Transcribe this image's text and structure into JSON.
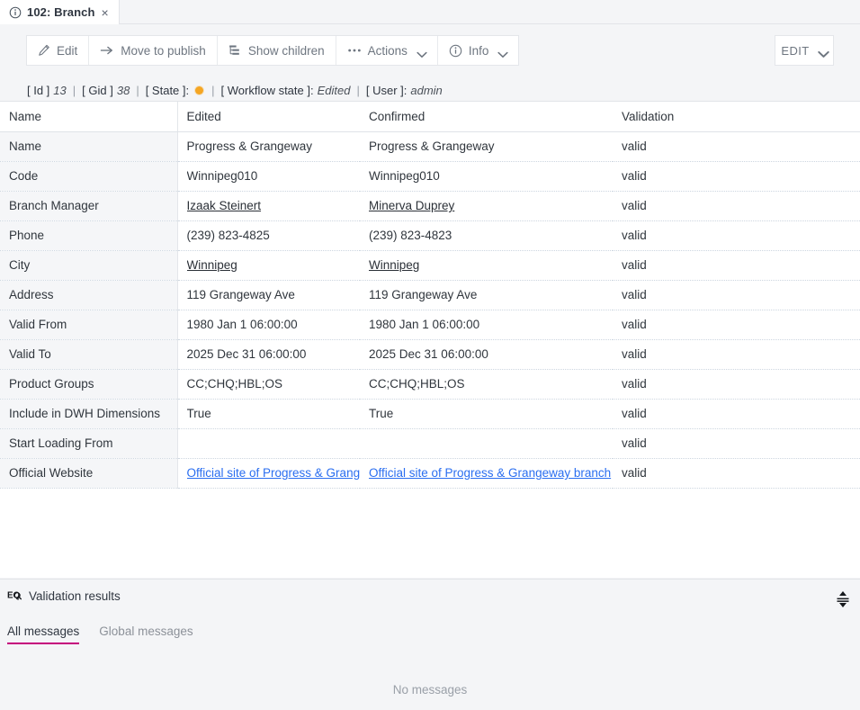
{
  "tab": {
    "icon": "info-circle-icon",
    "title": "102: Branch",
    "close": "×"
  },
  "toolbar": {
    "buttons": [
      {
        "icon": "pencil-icon",
        "label": "Edit",
        "caret": false
      },
      {
        "icon": "arrow-right-icon",
        "label": "Move to publish",
        "caret": false
      },
      {
        "icon": "tree-icon",
        "label": "Show children",
        "caret": false
      },
      {
        "icon": "ellipsis-icon",
        "label": "Actions",
        "caret": true
      },
      {
        "icon": "info-circle-icon",
        "label": "Info",
        "caret": true
      }
    ],
    "edit_mode": {
      "label": "EDIT",
      "caret": true
    }
  },
  "meta": {
    "id_key": "[ Id ]",
    "id_value": "13",
    "gid_key": "[ Gid ]",
    "gid_value": "38",
    "state_key": "[ State ]:",
    "state_color": "#f5a623",
    "workflow_key": "[ Workflow state ]:",
    "workflow_value": "Edited",
    "user_key": "[ User ]:",
    "user_value": "admin",
    "separator": "|"
  },
  "table": {
    "headers": [
      "Name",
      "Edited",
      "Confirmed",
      "Validation"
    ],
    "rows": [
      {
        "name": "Name",
        "edited": "Progress & Grangeway",
        "confirmed": "Progress & Grangeway",
        "validation": "valid",
        "edited_type": "text",
        "confirmed_type": "text"
      },
      {
        "name": "Code",
        "edited": "Winnipeg010",
        "confirmed": "Winnipeg010",
        "validation": "valid",
        "edited_type": "text",
        "confirmed_type": "text"
      },
      {
        "name": "Branch Manager",
        "edited": "Izaak Steinert",
        "confirmed": "Minerva Duprey",
        "validation": "valid",
        "edited_type": "ref",
        "confirmed_type": "ref"
      },
      {
        "name": "Phone",
        "edited": "(239) 823-4825",
        "confirmed": "(239) 823-4823",
        "validation": "valid",
        "edited_type": "text",
        "confirmed_type": "text"
      },
      {
        "name": "City",
        "edited": "Winnipeg",
        "confirmed": "Winnipeg",
        "validation": "valid",
        "edited_type": "ref",
        "confirmed_type": "ref"
      },
      {
        "name": "Address",
        "edited": "119 Grangeway Ave",
        "confirmed": "119 Grangeway Ave",
        "validation": "valid",
        "edited_type": "text",
        "confirmed_type": "text"
      },
      {
        "name": "Valid From",
        "edited": "1980 Jan 1 06:00:00",
        "confirmed": "1980 Jan 1 06:00:00",
        "validation": "valid",
        "edited_type": "text",
        "confirmed_type": "text"
      },
      {
        "name": "Valid To",
        "edited": "2025 Dec 31 06:00:00",
        "confirmed": "2025 Dec 31 06:00:00",
        "validation": "valid",
        "edited_type": "text",
        "confirmed_type": "text"
      },
      {
        "name": "Product Groups",
        "edited": "CC;CHQ;HBL;OS",
        "confirmed": "CC;CHQ;HBL;OS",
        "validation": "valid",
        "edited_type": "text",
        "confirmed_type": "text"
      },
      {
        "name": "Include in DWH Dimensions",
        "edited": "True",
        "confirmed": "True",
        "validation": "valid",
        "edited_type": "text",
        "confirmed_type": "text"
      },
      {
        "name": "Start Loading From",
        "edited": "",
        "confirmed": "",
        "validation": "valid",
        "edited_type": "text",
        "confirmed_type": "text"
      },
      {
        "name": "Official Website",
        "edited": "Official site of Progress & Grangeway branch",
        "confirmed": "Official site of Progress & Grangeway branch",
        "validation": "valid",
        "edited_type": "link",
        "confirmed_type": "link"
      }
    ]
  },
  "bottom": {
    "icon": "validation-results-icon",
    "title": "Validation results",
    "resize_icon": "vertical-resize-icon",
    "tabs": [
      {
        "label": "All messages",
        "active": true,
        "accent": "#c5007c"
      },
      {
        "label": "Global messages",
        "active": false,
        "accent": ""
      }
    ],
    "empty_text": "No messages"
  }
}
